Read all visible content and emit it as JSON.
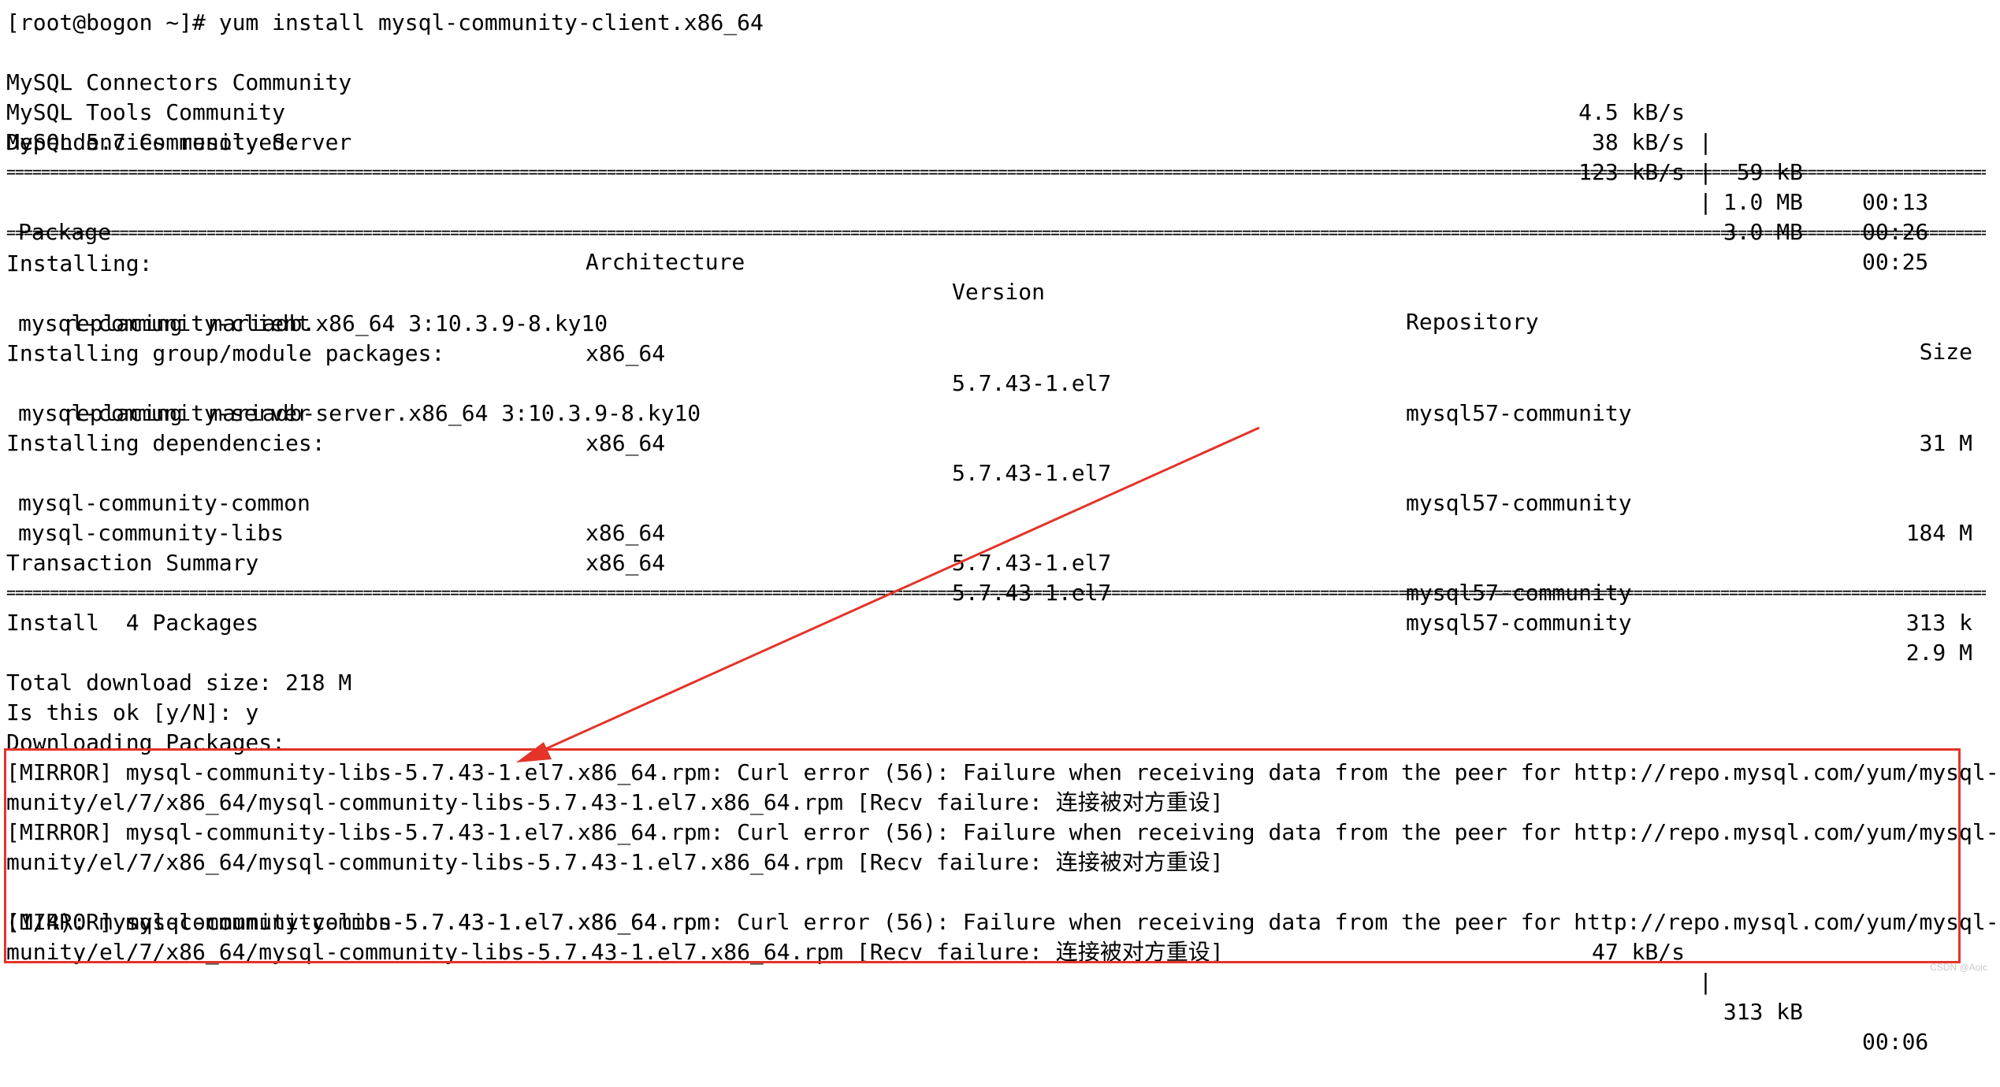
{
  "terminal": {
    "prompt_line": "[root@bogon ~]# yum install mysql-community-client.x86_64",
    "repos": [
      {
        "name": "MySQL Connectors Community",
        "speed": "4.5 kB/s",
        "size": " 59 kB",
        "time": "00:13"
      },
      {
        "name": "MySQL Tools Community",
        "speed": "38 kB/s",
        "size": "1.0 MB",
        "time": "00:26"
      },
      {
        "name": "MySQL 5.7 Community Server",
        "speed": "123 kB/s",
        "size": "3.0 MB",
        "time": "00:25"
      }
    ],
    "deps_resolved": "Dependencies resolved.",
    "separator": "================================================================================================================================================================================================================================================================================",
    "table_headers": {
      "package": "Package",
      "arch": "Architecture",
      "version": "Version",
      "repo": "Repository",
      "size": "Size"
    },
    "installing_label": "Installing:",
    "group_label": "Installing group/module packages:",
    "deps_label": "Installing dependencies:",
    "packages": [
      {
        "name": "mysql-community-client",
        "arch": "x86_64",
        "version": "5.7.43-1.el7",
        "repo": "mysql57-community",
        "size": "31 M",
        "replacing": "replacing  mariadb.x86_64 3:10.3.9-8.ky10"
      },
      {
        "name": "mysql-community-server",
        "arch": "x86_64",
        "version": "5.7.43-1.el7",
        "repo": "mysql57-community",
        "size": "184 M",
        "replacing": "replacing  mariadb-server.x86_64 3:10.3.9-8.ky10"
      },
      {
        "name": "mysql-community-common",
        "arch": "x86_64",
        "version": "5.7.43-1.el7",
        "repo": "mysql57-community",
        "size": "313 k"
      },
      {
        "name": "mysql-community-libs",
        "arch": "x86_64",
        "version": "5.7.43-1.el7",
        "repo": "mysql57-community",
        "size": "2.9 M"
      }
    ],
    "transaction_summary": "Transaction Summary",
    "install_count": "Install  4 Packages",
    "total_size": "Total download size: 218 M",
    "confirm": "Is this ok [y/N]: y",
    "downloading": "Downloading Packages:",
    "errors": [
      "[MIRROR] mysql-community-libs-5.7.43-1.el7.x86_64.rpm: Curl error (56): Failure when receiving data from the peer for http://repo.mysql.com/yum/mysql-5.7-com",
      "munity/el/7/x86_64/mysql-community-libs-5.7.43-1.el7.x86_64.rpm [Recv failure: 连接被对方重设]",
      "[MIRROR] mysql-community-libs-5.7.43-1.el7.x86_64.rpm: Curl error (56): Failure when receiving data from the peer for http://repo.mysql.com/yum/mysql-5.7-com",
      "munity/el/7/x86_64/mysql-community-libs-5.7.43-1.el7.x86_64.rpm [Recv failure: 连接被对方重设]"
    ],
    "progress": {
      "name": "(1/4): mysql-community-common-5.7.43-1.el7.x86_64.rpm",
      "speed": "47 kB/s",
      "size": "313 kB",
      "time": "00:06"
    },
    "error3a": "[MIRROR] mysql-community-libs-5.7.43-1.el7.x86_64.rpm: Curl error (56): Failure when receiving data from the peer for http://repo.mysql.com/yum/mysql-5.7-com",
    "error3b": "munity/el/7/x86_64/mysql-community-libs-5.7.43-1.el7.x86_64.rpm [Recv failure: 连接被对方重设]",
    "watermark": "CSDN @Aoic",
    "annotation_color": "#e53329"
  }
}
